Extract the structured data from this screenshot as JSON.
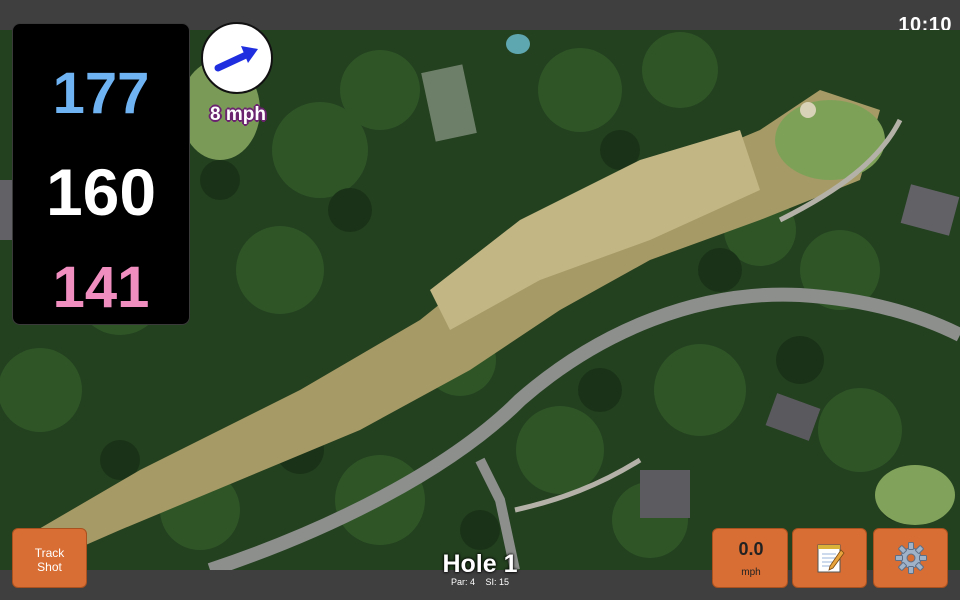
{
  "status": {
    "time": "10:10"
  },
  "distances": {
    "back": "177",
    "middle": "160",
    "front": "141"
  },
  "wind": {
    "speed_label": "8 mph",
    "arrow_color": "#1f2fe0"
  },
  "buttons": {
    "track_shot_line1": "Track",
    "track_shot_line2": "Shot",
    "speed_value": "0.0",
    "speed_unit": "mph",
    "notes_icon": "notepad-icon",
    "settings_icon": "gear-icon"
  },
  "hole": {
    "title": "Hole 1",
    "par": "Par: 4",
    "si": "SI: 15"
  },
  "colors": {
    "accent": "#d86e33",
    "back": "#6fb3f3",
    "front": "#f08ec0",
    "middle": "#ffffff"
  }
}
